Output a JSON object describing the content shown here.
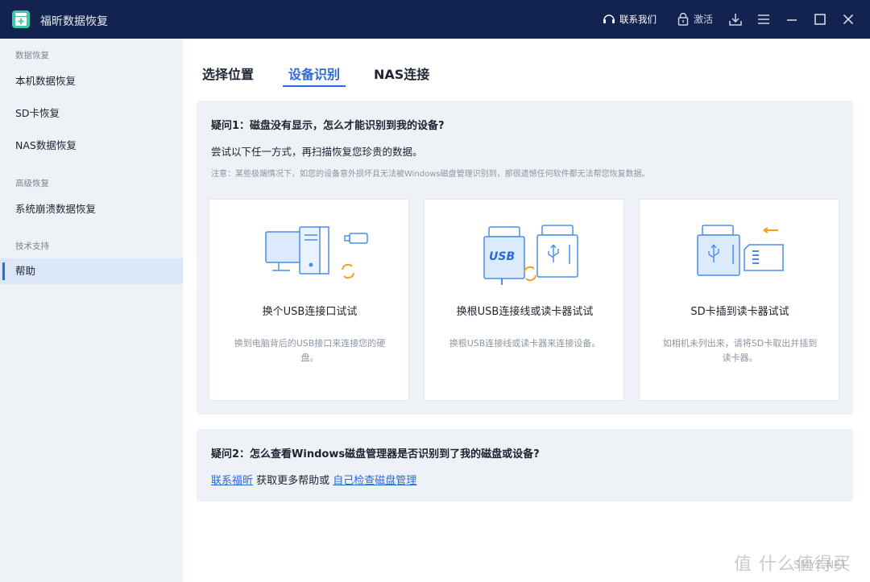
{
  "window": {
    "title": "福昕数据恢复",
    "contact_label": "联系我们",
    "activate_label": "激活"
  },
  "sidebar": {
    "sections": [
      {
        "label": "数据恢复",
        "items": [
          "本机数据恢复",
          "SD卡恢复",
          "NAS数据恢复"
        ]
      },
      {
        "label": "高级恢复",
        "items": [
          "系统崩溃数据恢复"
        ]
      },
      {
        "label": "技术支持",
        "items": [
          "帮助"
        ]
      }
    ],
    "active_item": "帮助"
  },
  "tabs": [
    {
      "label": "选择位置"
    },
    {
      "label": "设备识别",
      "active": true
    },
    {
      "label": "NAS连接"
    }
  ],
  "q1": {
    "title": "疑问1：磁盘没有显示，怎么才能识别到我的设备?",
    "subtitle": "尝试以下任一方式，再扫描恢复您珍贵的数据。",
    "note": "注意：某些极端情况下，如您的设备意外损坏且无法被Windows磁盘管理识别到，那很遗憾任何软件都无法帮您恢复数据。"
  },
  "cards": [
    {
      "icon": "computer-usb-icon",
      "title": "换个USB连接口试试",
      "desc": "换到电脑背后的USB接口来连接您的硬盘。"
    },
    {
      "icon": "usb-cable-icon",
      "title": "换根USB连接线或读卡器试试",
      "desc": "换根USB连接线或读卡器来连接设备。"
    },
    {
      "icon": "sd-card-reader-icon",
      "title": "SD卡插到读卡器试试",
      "desc": "如相机未列出来，请将SD卡取出并插到读卡器。"
    }
  ],
  "q2": {
    "title": "疑问2：怎么查看Windows磁盘管理器是否识别到了我的磁盘或设备?",
    "link1": "联系福昕",
    "middle": " 获取更多帮助或 ",
    "link2": "自己检查磁盘管理"
  },
  "watermark": {
    "text": "值 什么值得买",
    "sub": "SMYZ.NET"
  },
  "colors": {
    "titlebar": "#12234f",
    "accent": "#2b6ad8",
    "sidebar_bg": "#eef1f6",
    "icon_blue": "#4a8de8",
    "icon_orange": "#f5a020"
  }
}
